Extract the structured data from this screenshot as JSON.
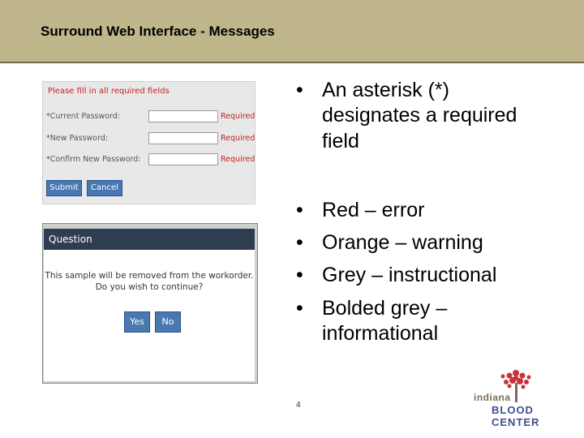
{
  "header": {
    "title": "Surround Web Interface - Messages"
  },
  "form_example": {
    "message": "Please fill in all required fields",
    "fields": [
      {
        "label": "*Current Password:",
        "status": "Required"
      },
      {
        "label": "*New Password:",
        "status": "Required"
      },
      {
        "label": "*Confirm New Password:",
        "status": "Required"
      }
    ],
    "submit_label": "Submit",
    "cancel_label": "Cancel"
  },
  "dialog_example": {
    "title": "Question",
    "message_line1": "This sample will be removed from the workorder.",
    "message_line2": "Do you wish to continue?",
    "yes_label": "Yes",
    "no_label": "No"
  },
  "bullets": {
    "first": {
      "line1": "An asterisk (*)",
      "line2": "designates a required",
      "line3": "field"
    },
    "red": "Red – error",
    "orange": "Orange – warning",
    "grey": "Grey – instructional",
    "bolded_line1": "Bolded grey –",
    "bolded_line2": "informational"
  },
  "page_number": "4",
  "logo": {
    "small_text": "indiana",
    "big_text": "BLOOD CENTER"
  },
  "colors": {
    "header_bg": "#bfb68c",
    "error_red": "#c41e1e",
    "button_blue": "#4778b3"
  }
}
